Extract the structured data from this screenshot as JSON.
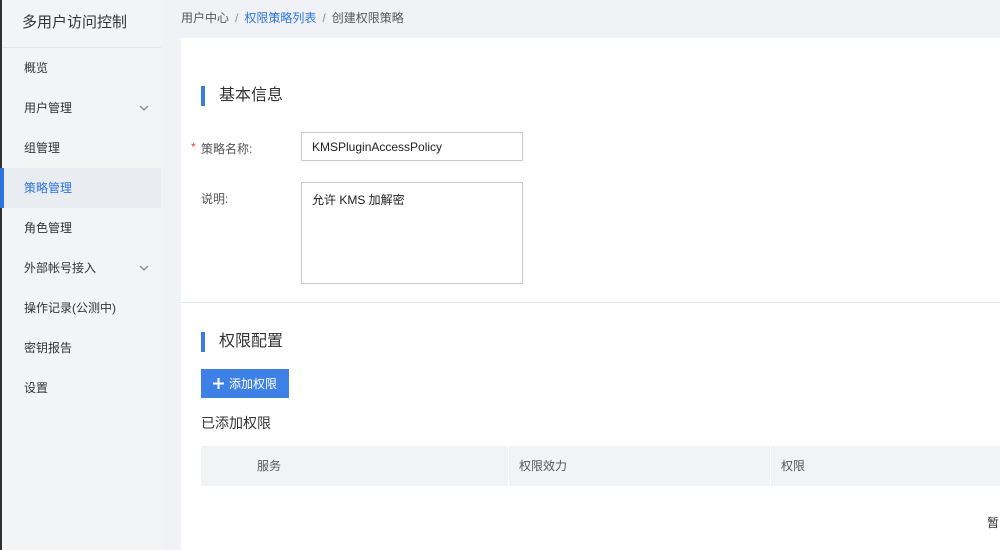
{
  "sidebar": {
    "title": "多用户访问控制",
    "items": [
      {
        "label": "概览"
      },
      {
        "label": "用户管理"
      },
      {
        "label": "组管理"
      },
      {
        "label": "策略管理"
      },
      {
        "label": "角色管理"
      },
      {
        "label": "外部帐号接入"
      },
      {
        "label": "操作记录(公测中)"
      },
      {
        "label": "密钥报告"
      },
      {
        "label": "设置"
      }
    ]
  },
  "breadcrumb": {
    "home": "用户中心",
    "list": "权限策略列表",
    "current": "创建权限策略"
  },
  "basic_info": {
    "title": "基本信息",
    "name_label": "策略名称:",
    "required_mark": "*",
    "name_value": "KMSPluginAccessPolicy",
    "desc_label": "说明:",
    "desc_value": "允许 KMS 加解密"
  },
  "permissions": {
    "title": "权限配置",
    "add_button": "添加权限",
    "added_title": "已添加权限",
    "columns": [
      "服务",
      "权限效力",
      "权限"
    ],
    "empty_text": "暂"
  },
  "colors": {
    "accent": "#2d74e0",
    "button": "#3d80e6"
  }
}
